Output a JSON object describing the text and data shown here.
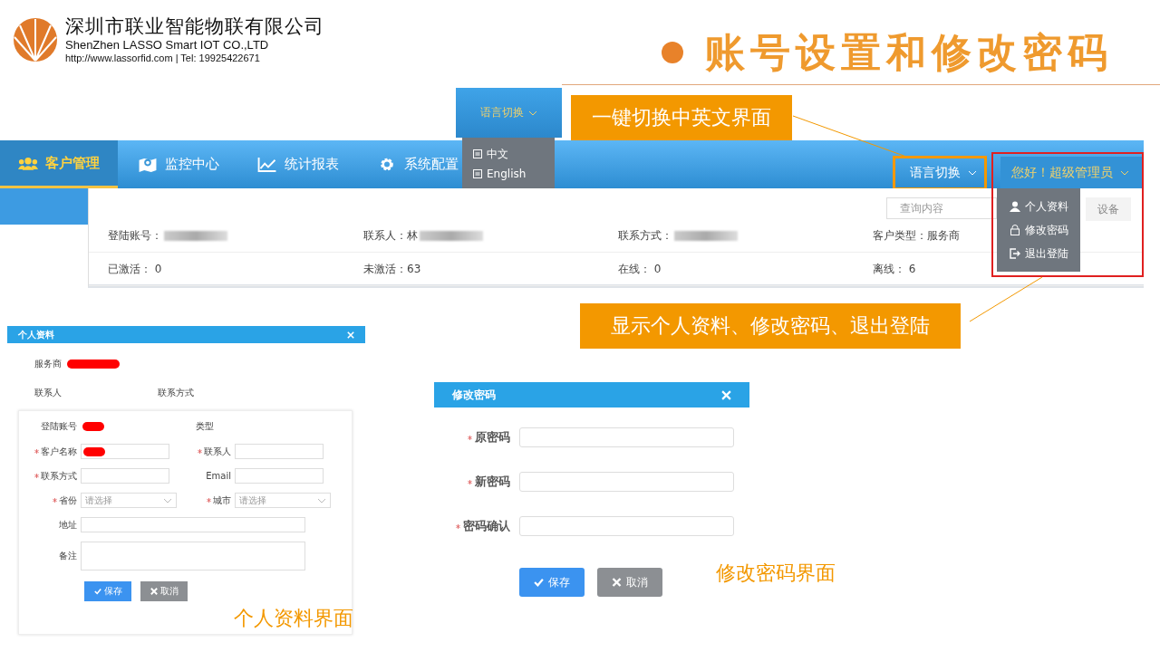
{
  "company": {
    "name_cn": "深圳市联业智能物联有限公司",
    "name_en": "ShenZhen LASSO Smart IOT CO.,LTD",
    "contact": "http://www.lassorfid.com | Tel:  19925422671"
  },
  "slide_title": "账号设置和修改密码",
  "nav": {
    "tabs": [
      {
        "label": "客户管理",
        "selected": true
      },
      {
        "label": "监控中心",
        "selected": false
      },
      {
        "label": "统计报表",
        "selected": false
      },
      {
        "label": "系统配置",
        "selected": false
      }
    ],
    "language_button": "语言切换",
    "user_button": "您好！超级管理员"
  },
  "language_zoom": {
    "label": "语言切换",
    "options": [
      "中文",
      "English"
    ]
  },
  "callouts": [
    "一键切换中英文界面",
    "显示个人资料、修改密码、退出登陆"
  ],
  "search": {
    "placeholder": "查询内容"
  },
  "device_button": "设备",
  "info_rows": [
    [
      {
        "label": "登陆账号：",
        "redacted": true
      },
      {
        "label": "联系人：林",
        "redacted": true
      },
      {
        "label": "联系方式：",
        "redacted": true
      },
      {
        "label": "客户类型：服务商",
        "redacted": false
      }
    ],
    [
      {
        "label": "已激活：  0",
        "redacted": false
      },
      {
        "label": "未激活：63",
        "redacted": false
      },
      {
        "label": "在线：  0",
        "redacted": false
      },
      {
        "label": "离线：  6",
        "redacted": false
      }
    ]
  ],
  "user_menu": [
    "个人资料",
    "修改密码",
    "退出登陆"
  ],
  "profile_dialog": {
    "title": "个人资料",
    "provider_label": "服务商",
    "contact_label": "联系人",
    "contact_method_label": "联系方式",
    "account_label": "登陆账号",
    "type_label": "类型",
    "fields": [
      {
        "label": "客户名称",
        "required": true,
        "redacted": true,
        "kind": "input"
      },
      {
        "label": "联系人",
        "required": true,
        "redacted": false,
        "kind": "input"
      },
      {
        "label": "联系方式",
        "required": true,
        "redacted": false,
        "kind": "input"
      },
      {
        "label": "Email",
        "required": false,
        "redacted": false,
        "kind": "input"
      },
      {
        "label": "省份",
        "required": true,
        "kind": "select",
        "placeholder": "请选择"
      },
      {
        "label": "城市",
        "required": true,
        "kind": "select",
        "placeholder": "请选择"
      },
      {
        "label": "地址",
        "required": false,
        "kind": "wide"
      },
      {
        "label": "备注",
        "required": false,
        "kind": "textarea"
      }
    ],
    "save": "保存",
    "cancel": "取消"
  },
  "password_dialog": {
    "title": "修改密码",
    "fields": [
      {
        "label": "原密码",
        "required": true
      },
      {
        "label": "新密码",
        "required": true
      },
      {
        "label": "密码确认",
        "required": true
      }
    ],
    "save": "保存",
    "cancel": "取消"
  },
  "captions": [
    "个人资料界面",
    "修改密码界面"
  ]
}
